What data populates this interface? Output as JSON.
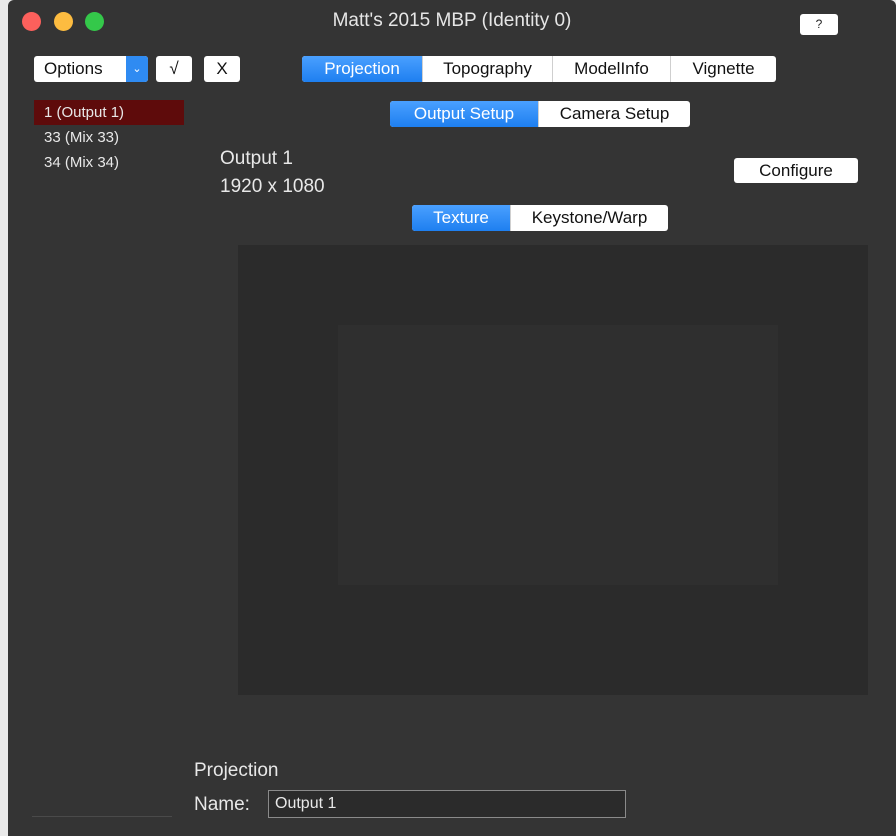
{
  "window": {
    "title": "Matt's 2015 MBP (Identity 0)",
    "help_label": "?"
  },
  "toolbar": {
    "options_label": "Options",
    "options_arrow": "⌄",
    "check_label": "√",
    "x_label": "X"
  },
  "main_tabs": [
    {
      "label": "Projection",
      "active": true
    },
    {
      "label": "Topography",
      "active": false
    },
    {
      "label": "ModelInfo",
      "active": false
    },
    {
      "label": "Vignette",
      "active": false
    }
  ],
  "setup_tabs": [
    {
      "label": "Output Setup",
      "active": true
    },
    {
      "label": "Camera Setup",
      "active": false
    }
  ],
  "sidebar": {
    "items": [
      {
        "label": "1 (Output 1)",
        "selected": true
      },
      {
        "label": "33 (Mix 33)",
        "selected": false
      },
      {
        "label": "34 (Mix 34)",
        "selected": false
      }
    ]
  },
  "output": {
    "name": "Output 1",
    "resolution": "1920 x 1080",
    "configure_label": "Configure"
  },
  "view_tabs": [
    {
      "label": "Texture",
      "active": true
    },
    {
      "label": "Keystone/Warp",
      "active": false
    }
  ],
  "bottom": {
    "section_label": "Projection",
    "name_label": "Name:",
    "name_value": "Output 1"
  },
  "colors": {
    "accent": "#2f8bf2",
    "selected_row": "#5e0b0b",
    "window_bg": "#343434"
  }
}
